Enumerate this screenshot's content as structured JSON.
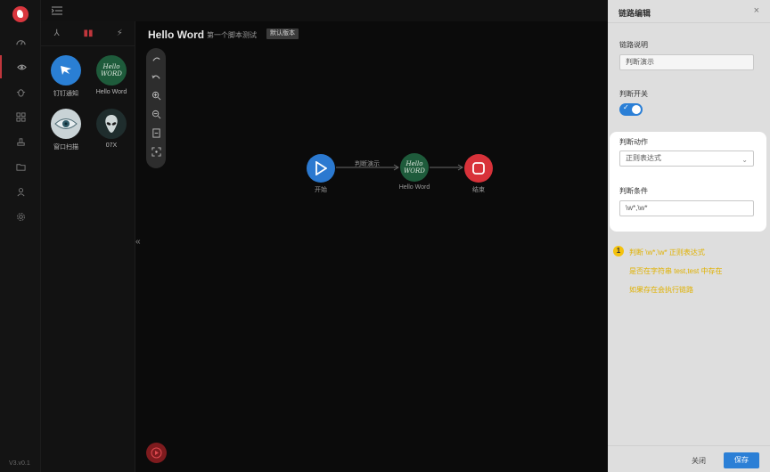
{
  "rail": {
    "items": [
      {
        "name": "dashboard-icon"
      },
      {
        "name": "eye-icon"
      },
      {
        "name": "bug-icon"
      },
      {
        "name": "grid-icon"
      },
      {
        "name": "stamp-icon"
      },
      {
        "name": "folder-icon"
      },
      {
        "name": "user-icon"
      },
      {
        "name": "gear-icon"
      }
    ],
    "version": "V3.v0.1"
  },
  "components": [
    {
      "label": "钉钉通知",
      "icon": "dingtalk-icon",
      "color": "#2a7fd4"
    },
    {
      "label": "Hello Word",
      "icon": "hello-word-icon",
      "color": "#1e5b3b",
      "text": "Hello WORD"
    },
    {
      "label": "窗口扫描",
      "icon": "window-scan-eye-icon",
      "color": "#c9d3d6"
    },
    {
      "label": "07X",
      "icon": "alien-icon",
      "color": "#1f2d2d"
    }
  ],
  "canvas": {
    "title": "Hello Word",
    "subtitle": "第一个脚本测试",
    "tag": "默认版本"
  },
  "flow": {
    "start_label": "开始",
    "edge_label": "判断演示",
    "middle_label": "Hello Word",
    "middle_text": "Hello WORD",
    "end_label": "结束"
  },
  "drawer": {
    "title": "链路编辑",
    "close": "×",
    "desc_label": "链路说明",
    "desc_value": "判断演示",
    "switch_label": "判断开关",
    "action_label": "判断动作",
    "action_value": "正则表达式",
    "cond_label": "判断条件",
    "cond_value": "\\w*,\\w*",
    "note_num": "1",
    "note_lines": [
      "判断 \\w*,\\w* 正则表达式",
      "是否在字符串 test,test 中存在",
      "如果存在会执行链路"
    ],
    "btn_close": "关闭",
    "btn_save": "保存"
  }
}
